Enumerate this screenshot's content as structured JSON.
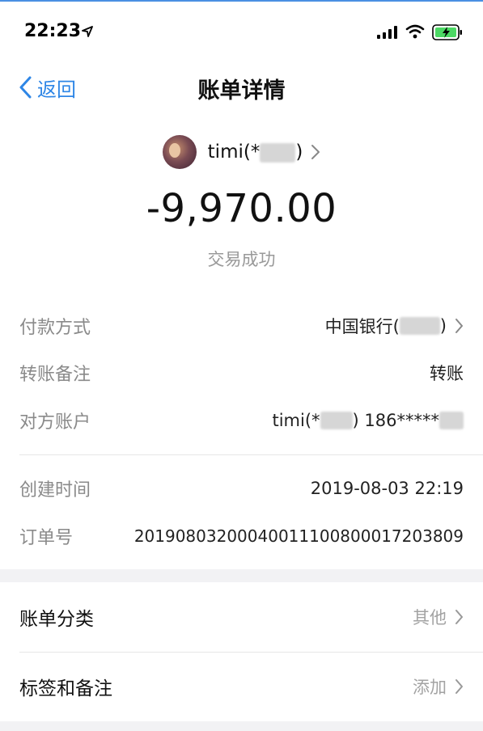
{
  "status_bar": {
    "time": "22:23"
  },
  "nav": {
    "back_label": "返回",
    "title": "账单详情"
  },
  "header": {
    "payee_name_prefix": "timi(*",
    "payee_name_suffix": ")",
    "amount": "-9,970.00",
    "status": "交易成功"
  },
  "details": [
    {
      "label": "付款方式",
      "value_prefix": "中国银行(",
      "value_suffix": ")"
    },
    {
      "label": "转账备注",
      "value": "转账"
    },
    {
      "label": "对方账户",
      "value_prefix": "timi(*",
      "value_suffix": ") 186*****"
    },
    {
      "label": "创建时间",
      "value": "2019-08-03 22:19"
    },
    {
      "label": "订单号",
      "value": "20190803200040011100800017203809"
    }
  ],
  "cells": [
    {
      "label": "账单分类",
      "value": "其他"
    },
    {
      "label": "标签和备注",
      "value": "添加"
    }
  ],
  "colors": {
    "accent": "#2e86e6",
    "secondary_text": "#8a8a8a",
    "section_gap": "#f2f2f4"
  }
}
